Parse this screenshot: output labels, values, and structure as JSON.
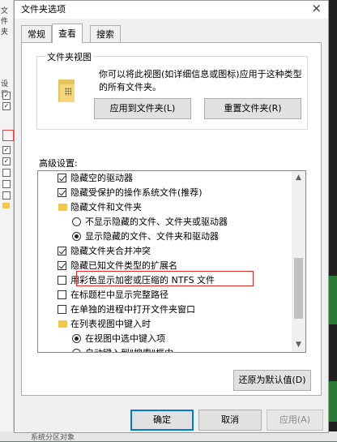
{
  "dialog": {
    "title": "文件夹选项",
    "close_glyph": "×",
    "tabs": [
      {
        "label": "常规",
        "active": false
      },
      {
        "label": "查看",
        "active": true
      },
      {
        "label": "搜索",
        "active": false
      }
    ],
    "folder_view": {
      "title": "文件夹视图",
      "description": "你可以将此视图(如详细信息或图标)应用于这种类型的所有文件夹。",
      "apply_button": "应用到文件夹(L)",
      "reset_button": "重置文件夹(R)"
    },
    "advanced": {
      "label": "高级设置:",
      "items": [
        {
          "type": "checkbox",
          "checked": true,
          "label": "隐藏空的驱动器"
        },
        {
          "type": "checkbox",
          "checked": true,
          "label": "隐藏受保护的操作系统文件(推荐)"
        },
        {
          "type": "folder",
          "label": "隐藏文件和文件夹"
        },
        {
          "type": "radio",
          "selected": false,
          "label": "不显示隐藏的文件、文件夹或驱动器"
        },
        {
          "type": "radio",
          "selected": true,
          "label": "显示隐藏的文件、文件夹和驱动器"
        },
        {
          "type": "checkbox",
          "checked": true,
          "label": "隐藏文件夹合并冲突"
        },
        {
          "type": "checkbox",
          "checked": true,
          "label": "隐藏已知文件类型的扩展名"
        },
        {
          "type": "checkbox",
          "checked": false,
          "label": "用彩色显示加密或压缩的 NTFS 文件"
        },
        {
          "type": "checkbox",
          "checked": false,
          "label": "在标题栏中显示完整路径"
        },
        {
          "type": "checkbox",
          "checked": false,
          "label": "在单独的进程中打开文件夹窗口"
        },
        {
          "type": "folder",
          "label": "在列表视图中键入时"
        },
        {
          "type": "radio",
          "selected": true,
          "label": "在视图中选中键入项"
        },
        {
          "type": "radio",
          "selected": false,
          "label": "自动键入到\"搜索\"框中"
        }
      ],
      "restore_button": "还原为默认值(D)"
    },
    "footer": {
      "ok": "确定",
      "cancel": "取消",
      "apply": "应用(A)"
    }
  },
  "background": {
    "left_texts": [
      "文件夹",
      "设置"
    ],
    "bottom_text": "系统分区对象"
  },
  "colors": {
    "highlight_border": "#e02a2a",
    "focus_border": "#0078d7"
  }
}
